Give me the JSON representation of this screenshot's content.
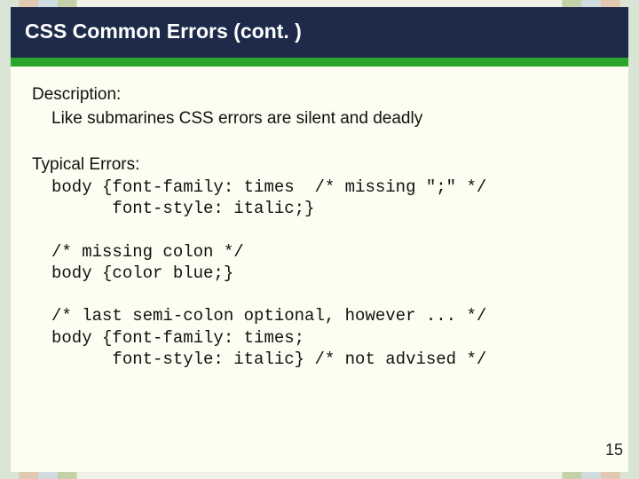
{
  "title": "CSS Common Errors (cont. )",
  "description_label": "Description:",
  "description_text": "Like submarines CSS errors are silent and deadly",
  "typical_label": "Typical Errors:",
  "code_blocks": [
    "body {font-family: times  /* missing \";\" */\n      font-style: italic;}",
    "/* missing colon */\nbody {color blue;}",
    "/* last semi-colon optional, however ... */\nbody {font-family: times;\n      font-style: italic} /* not advised */"
  ],
  "page_number": "15"
}
